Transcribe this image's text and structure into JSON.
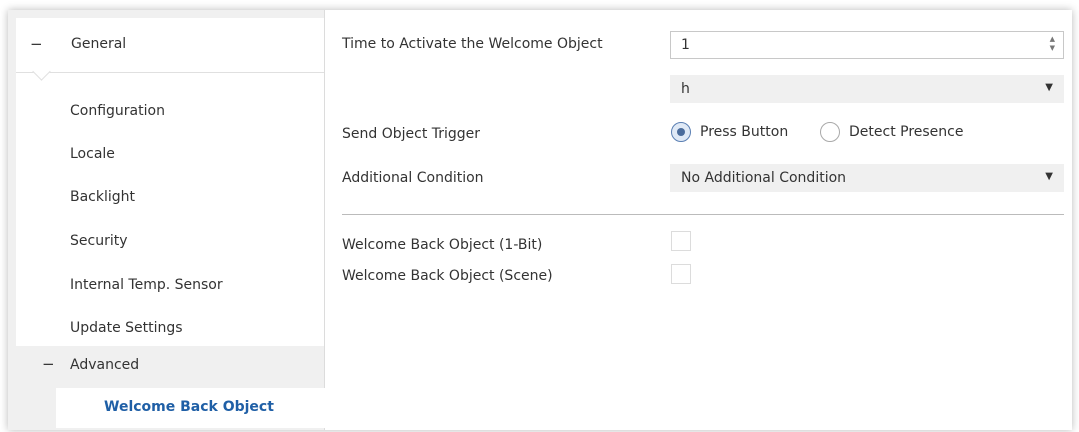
{
  "sidebar": {
    "header": {
      "toggle": "−",
      "label": "General"
    },
    "items": [
      {
        "label": "Configuration"
      },
      {
        "label": "Locale"
      },
      {
        "label": "Backlight"
      },
      {
        "label": "Security"
      },
      {
        "label": "Internal Temp. Sensor"
      },
      {
        "label": "Update Settings"
      }
    ],
    "advanced": {
      "toggle": "−",
      "label": "Advanced"
    },
    "selected_item": {
      "label": "Welcome Back Object"
    }
  },
  "params": {
    "time_to_activate": {
      "label": "Time to Activate the Welcome Object",
      "value": "1"
    },
    "time_unit": {
      "value": "h"
    },
    "send_object_trigger": {
      "label": "Send Object Trigger",
      "options": [
        {
          "label": "Press Button",
          "selected": true
        },
        {
          "label": "Detect Presence",
          "selected": false
        }
      ]
    },
    "additional_condition": {
      "label": "Additional Condition",
      "value": "No Additional Condition"
    },
    "welcome_back_1bit": {
      "label": "Welcome Back Object (1-Bit)",
      "checked": false
    },
    "welcome_back_scene": {
      "label": "Welcome Back Object (Scene)",
      "checked": false
    }
  },
  "icons": {
    "spin_up": "▲",
    "spin_down": "▼",
    "dropdown": "▼"
  },
  "colors": {
    "selected_text": "#1f5fa6",
    "sidebar_bg": "#f0f0f0",
    "select_bg": "#f0f0f0"
  }
}
